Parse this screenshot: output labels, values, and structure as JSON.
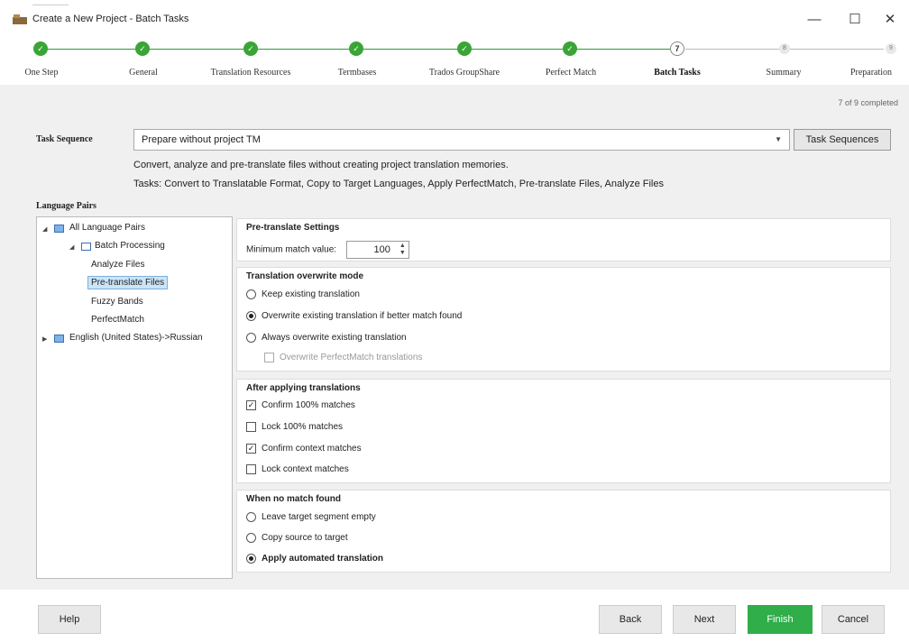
{
  "window": {
    "title": "Create a New Project - Batch Tasks",
    "controls": {
      "minimize": "—",
      "maximize": "☐",
      "close": "✕"
    }
  },
  "steps": [
    {
      "label": "One Step",
      "state": "done"
    },
    {
      "label": "General",
      "state": "done"
    },
    {
      "label": "Translation Resources",
      "state": "done"
    },
    {
      "label": "Termbases",
      "state": "done"
    },
    {
      "label": "Trados GroupShare",
      "state": "done"
    },
    {
      "label": "Perfect Match",
      "state": "done"
    },
    {
      "label": "Batch Tasks",
      "state": "current",
      "number": "7"
    },
    {
      "label": "Summary",
      "state": "pending",
      "number": "8"
    },
    {
      "label": "Preparation",
      "state": "pending",
      "number": "9"
    }
  ],
  "progress_text": "7 of 9 completed",
  "task_sequence": {
    "label": "Task Sequence",
    "selected": "Prepare without project TM",
    "button": "Task Sequences",
    "description": "Convert, analyze and pre-translate files without creating project translation memories.",
    "tasks": "Tasks: Convert to Translatable Format, Copy to Target Languages, Apply PerfectMatch, Pre-translate Files, Analyze Files"
  },
  "language_pairs": {
    "label": "Language Pairs",
    "tree": {
      "all": "All Language Pairs",
      "batch": "Batch Processing",
      "items": [
        "Analyze Files",
        "Pre-translate Files",
        "Fuzzy Bands",
        "PerfectMatch"
      ],
      "selected": "Pre-translate Files",
      "pair": "English (United States)->Russian"
    }
  },
  "pretranslate": {
    "title": "Pre-translate Settings",
    "min_match_label": "Minimum match value:",
    "min_match_value": "100"
  },
  "overwrite": {
    "title": "Translation overwrite mode",
    "options": [
      {
        "label": "Keep existing translation",
        "selected": false
      },
      {
        "label": "Overwrite existing translation if better match found",
        "selected": true
      },
      {
        "label": "Always overwrite existing translation",
        "selected": false
      }
    ],
    "sub_check": {
      "label": "Overwrite PerfectMatch translations",
      "checked": false,
      "disabled": true
    }
  },
  "after_apply": {
    "title": "After applying translations",
    "checks": [
      {
        "label": "Confirm 100% matches",
        "checked": true
      },
      {
        "label": "Lock 100% matches",
        "checked": false
      },
      {
        "label": "Confirm context matches",
        "checked": true
      },
      {
        "label": "Lock context matches",
        "checked": false
      }
    ]
  },
  "no_match": {
    "title": "When no match found",
    "options": [
      {
        "label": "Leave target segment empty",
        "selected": false
      },
      {
        "label": "Copy source to target",
        "selected": false
      },
      {
        "label": "Apply automated translation",
        "selected": true
      }
    ]
  },
  "footer": {
    "help": "Help",
    "back": "Back",
    "next": "Next",
    "finish": "Finish",
    "cancel": "Cancel"
  },
  "colors": {
    "done": "#3aa536",
    "finish": "#2fae4a",
    "selection": "#cce4f7"
  }
}
